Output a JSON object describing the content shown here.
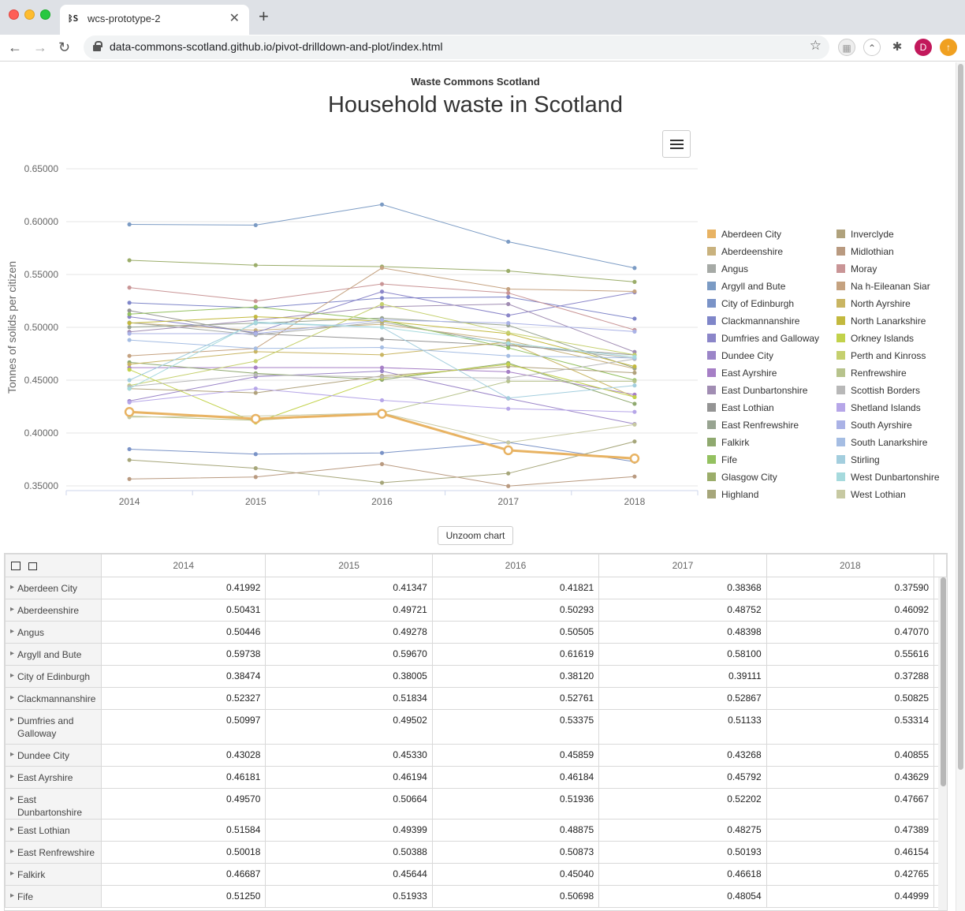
{
  "browser": {
    "tab_title": "wcs-prototype-2",
    "tab_icon_text": "ᛒS",
    "url": "data-commons-scotland.github.io/pivot-drilldown-and-plot/index.html",
    "profile_initial": "D"
  },
  "page": {
    "subtitle": "Waste Commons Scotland",
    "title": "Household waste in Scotland",
    "unzoom_label": "Unzoom chart"
  },
  "chart_data": {
    "type": "line",
    "title": "Household waste in Scotland",
    "subtitle": "Waste Commons Scotland",
    "ylabel": "Tonnes of solids per citizen",
    "xlabel": "",
    "x": [
      "2014",
      "2015",
      "2016",
      "2017",
      "2018"
    ],
    "ylim": [
      0.35,
      0.65
    ],
    "yticks": [
      "0.35000",
      "0.40000",
      "0.45000",
      "0.50000",
      "0.55000",
      "0.60000",
      "0.65000"
    ],
    "grid": true,
    "legend_position": "right",
    "highlighted_series": "Aberdeen City",
    "series": [
      {
        "name": "Aberdeen City",
        "color": "#e8b363",
        "values": [
          0.41992,
          0.41347,
          0.41821,
          0.38368,
          0.3759
        ]
      },
      {
        "name": "Aberdeenshire",
        "color": "#c9b27e",
        "values": [
          0.50431,
          0.49721,
          0.50293,
          0.48752,
          0.46092
        ]
      },
      {
        "name": "Angus",
        "color": "#a6aaa6",
        "values": [
          0.50446,
          0.49278,
          0.50505,
          0.48398,
          0.4707
        ]
      },
      {
        "name": "Argyll and Bute",
        "color": "#7b9bc4",
        "values": [
          0.59738,
          0.5967,
          0.61619,
          0.581,
          0.55616
        ]
      },
      {
        "name": "City of Edinburgh",
        "color": "#7a93c7",
        "values": [
          0.38474,
          0.38005,
          0.3812,
          0.39111,
          0.37288
        ]
      },
      {
        "name": "Clackmannanshire",
        "color": "#7f86c9",
        "values": [
          0.52327,
          0.51834,
          0.52761,
          0.52867,
          0.50825
        ]
      },
      {
        "name": "Dumfries and Galloway",
        "color": "#8b86c9",
        "values": [
          0.50997,
          0.49502,
          0.53375,
          0.51133,
          0.53314
        ]
      },
      {
        "name": "Dundee City",
        "color": "#9b85c8",
        "values": [
          0.43028,
          0.4533,
          0.45859,
          0.43268,
          0.40855
        ]
      },
      {
        "name": "East Ayrshire",
        "color": "#a67fc6",
        "values": [
          0.46181,
          0.46194,
          0.46184,
          0.45792,
          0.43629
        ]
      },
      {
        "name": "East Dunbartonshire",
        "color": "#a18db3",
        "values": [
          0.4957,
          0.50664,
          0.51936,
          0.52202,
          0.47667
        ]
      },
      {
        "name": "East Lothian",
        "color": "#949494",
        "values": [
          0.51584,
          0.49399,
          0.48875,
          0.48275,
          0.47389
        ]
      },
      {
        "name": "East Renfrewshire",
        "color": "#98a491",
        "values": [
          0.50018,
          0.50388,
          0.50873,
          0.50193,
          0.46154
        ]
      },
      {
        "name": "Falkirk",
        "color": "#8fa96f",
        "values": [
          0.46687,
          0.45644,
          0.4504,
          0.46618,
          0.42765
        ]
      },
      {
        "name": "Fife",
        "color": "#94c160",
        "values": [
          0.5125,
          0.51933,
          0.50698,
          0.48054,
          0.44999
        ]
      },
      {
        "name": "Glasgow City",
        "color": "#9bad6a",
        "values": [
          0.56343,
          0.5588,
          0.5575,
          0.55335,
          0.543
        ]
      },
      {
        "name": "Highland",
        "color": "#a6a67a",
        "values": [
          0.3745,
          0.3667,
          0.353,
          0.3618,
          0.392
        ]
      },
      {
        "name": "Inverclyde",
        "color": "#b0a27c",
        "values": [
          0.442,
          0.438,
          0.454,
          0.463,
          0.457
        ]
      },
      {
        "name": "Midlothian",
        "color": "#b99a80",
        "values": [
          0.3565,
          0.3584,
          0.3706,
          0.3498,
          0.3588
        ]
      },
      {
        "name": "Moray",
        "color": "#c99596",
        "values": [
          0.5376,
          0.5248,
          0.541,
          0.5325,
          0.4975
        ]
      },
      {
        "name": "Na h-Eileanan Siar",
        "color": "#c5a280",
        "values": [
          0.473,
          0.48,
          0.5562,
          0.5362,
          0.534
        ]
      },
      {
        "name": "North Ayrshire",
        "color": "#c9b562",
        "values": [
          0.465,
          0.477,
          0.474,
          0.486,
          0.434
        ]
      },
      {
        "name": "North Lanarkshire",
        "color": "#c3b93e",
        "values": [
          0.504,
          0.51,
          0.506,
          0.494,
          0.463
        ]
      },
      {
        "name": "Orkney Islands",
        "color": "#c2d24b",
        "values": [
          0.46,
          0.41,
          0.452,
          0.465,
          0.434
        ]
      },
      {
        "name": "Perth and Kinross",
        "color": "#c5d06e",
        "values": [
          0.445,
          0.468,
          0.522,
          0.495,
          0.474
        ]
      },
      {
        "name": "Renfrewshire",
        "color": "#b7c38c",
        "values": [
          0.416,
          0.412,
          0.419,
          0.449,
          0.449
        ]
      },
      {
        "name": "Scottish Borders",
        "color": "#b8b8b8",
        "values": [
          0.444,
          0.455,
          0.453,
          0.452,
          0.47
        ]
      },
      {
        "name": "Shetland Islands",
        "color": "#b6a6e8",
        "values": [
          0.429,
          0.442,
          0.431,
          0.423,
          0.42
        ]
      },
      {
        "name": "South Ayrshire",
        "color": "#aab2e6",
        "values": [
          0.494,
          0.494,
          0.507,
          0.504,
          0.496
        ]
      },
      {
        "name": "South Lanarkshire",
        "color": "#a5bde3",
        "values": [
          0.488,
          0.48,
          0.481,
          0.473,
          0.471
        ]
      },
      {
        "name": "Stirling",
        "color": "#a3cede",
        "values": [
          0.45,
          0.504,
          0.5,
          0.433,
          0.445
        ]
      },
      {
        "name": "West Dunbartonshire",
        "color": "#a6dadd",
        "values": [
          0.442,
          0.505,
          0.5,
          0.485,
          0.472
        ]
      },
      {
        "name": "West Lothian",
        "color": "#c7c9a2",
        "values": [
          0.415,
          0.416,
          0.419,
          0.391,
          0.408
        ]
      }
    ]
  },
  "table": {
    "columns": [
      "2014",
      "2015",
      "2016",
      "2017",
      "2018"
    ],
    "rows": [
      {
        "label": "Aberdeen City",
        "values": [
          "0.41992",
          "0.41347",
          "0.41821",
          "0.38368",
          "0.37590"
        ]
      },
      {
        "label": "Aberdeenshire",
        "values": [
          "0.50431",
          "0.49721",
          "0.50293",
          "0.48752",
          "0.46092"
        ]
      },
      {
        "label": "Angus",
        "values": [
          "0.50446",
          "0.49278",
          "0.50505",
          "0.48398",
          "0.47070"
        ]
      },
      {
        "label": "Argyll and Bute",
        "values": [
          "0.59738",
          "0.59670",
          "0.61619",
          "0.58100",
          "0.55616"
        ]
      },
      {
        "label": "City of Edinburgh",
        "values": [
          "0.38474",
          "0.38005",
          "0.38120",
          "0.39111",
          "0.37288"
        ]
      },
      {
        "label": "Clackmannanshire",
        "values": [
          "0.52327",
          "0.51834",
          "0.52761",
          "0.52867",
          "0.50825"
        ]
      },
      {
        "label": "Dumfries and Galloway",
        "values": [
          "0.50997",
          "0.49502",
          "0.53375",
          "0.51133",
          "0.53314"
        ]
      },
      {
        "label": "Dundee City",
        "values": [
          "0.43028",
          "0.45330",
          "0.45859",
          "0.43268",
          "0.40855"
        ]
      },
      {
        "label": "East Ayrshire",
        "values": [
          "0.46181",
          "0.46194",
          "0.46184",
          "0.45792",
          "0.43629"
        ]
      },
      {
        "label": "East Dunbartonshire",
        "values": [
          "0.49570",
          "0.50664",
          "0.51936",
          "0.52202",
          "0.47667"
        ]
      },
      {
        "label": "East Lothian",
        "values": [
          "0.51584",
          "0.49399",
          "0.48875",
          "0.48275",
          "0.47389"
        ]
      },
      {
        "label": "East Renfrewshire",
        "values": [
          "0.50018",
          "0.50388",
          "0.50873",
          "0.50193",
          "0.46154"
        ]
      },
      {
        "label": "Falkirk",
        "values": [
          "0.46687",
          "0.45644",
          "0.45040",
          "0.46618",
          "0.42765"
        ]
      },
      {
        "label": "Fife",
        "values": [
          "0.51250",
          "0.51933",
          "0.50698",
          "0.48054",
          "0.44999"
        ]
      }
    ]
  }
}
